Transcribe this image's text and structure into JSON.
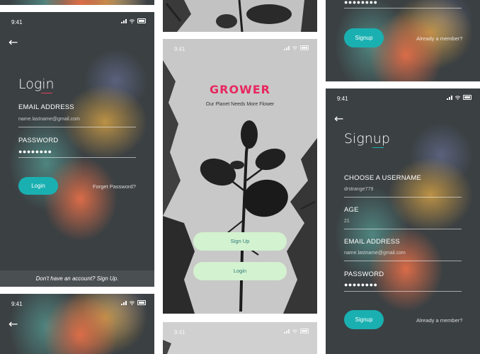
{
  "status_time": "9:41",
  "login": {
    "title": "Login",
    "email_label": "EMAIL ADDRESS",
    "email_value": "name.lastname@gmail.com",
    "password_label": "PASSWORD",
    "password_value": "●●●●●●●●",
    "login_button": "Login",
    "forgot_link": "Forget Password?",
    "footer_text": "Don't have an account? Sign Up."
  },
  "welcome": {
    "brand": "GROWER",
    "tagline": "Our Planet Needs More Flower",
    "signup_button": "Sign Up",
    "login_button": "Login"
  },
  "signup_top": {
    "password_value": "●●●●●●●●",
    "signup_button": "Signup",
    "member_link": "Already a member?"
  },
  "signup": {
    "title": "Signup",
    "username_label": "CHOOSE A USERNAME",
    "username_value": "drstrange779",
    "age_label": "AGE",
    "age_value": "21",
    "email_label": "EMAIL ADDRESS",
    "email_value": "name.lastname@gmail.com",
    "password_label": "PASSWORD",
    "password_value": "●●●●●●●●",
    "signup_button": "Signup",
    "member_link": "Already a member?"
  },
  "colors": {
    "accent_teal": "#1ab0b1",
    "brand_pink": "#e8275f",
    "button_green": "#d3f2cf",
    "dark_bg": "#3b4043"
  },
  "icons": [
    "back-arrow-icon",
    "signal-icon",
    "wifi-icon",
    "battery-icon",
    "plant-image"
  ]
}
